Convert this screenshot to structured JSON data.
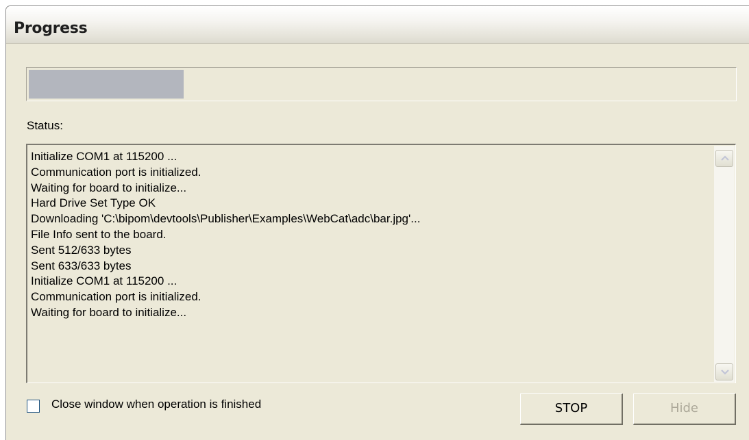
{
  "window": {
    "title": "Progress"
  },
  "progress": {
    "fraction": 0.22,
    "fill_color": "#b3b6be"
  },
  "status": {
    "label": "Status:",
    "lines": [
      "Initialize COM1 at 115200 ...",
      "Communication port is initialized.",
      "Waiting for board to initialize...",
      "Hard Drive Set Type OK",
      "Downloading 'C:\\bipom\\devtools\\Publisher\\Examples\\WebCat\\adc\\bar.jpg'...",
      "File Info sent to the board.",
      "Sent 512/633 bytes",
      "Sent 633/633 bytes",
      "Initialize COM1 at 115200 ...",
      "Communication port is initialized.",
      "Waiting for board to initialize..."
    ]
  },
  "icons": {
    "scroll_up": "chevron-up-icon",
    "scroll_down": "chevron-down-icon"
  },
  "close_when_finished": {
    "label": "Close window when operation is finished",
    "checked": false
  },
  "buttons": {
    "stop_label": "STOP",
    "hide_label": "Hide",
    "hide_enabled": false
  }
}
